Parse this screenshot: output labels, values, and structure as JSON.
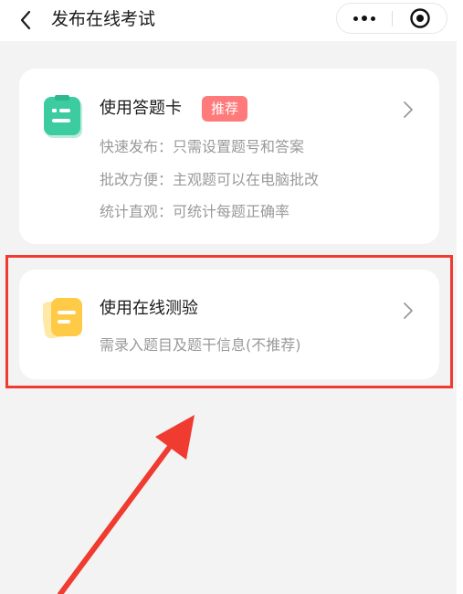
{
  "nav": {
    "title": "发布在线考试",
    "back_icon": "chevron-left-icon",
    "more_icon": "more-dots-icon",
    "close_icon": "target-circle-icon"
  },
  "options": [
    {
      "title": "使用答题卡",
      "badge": "推荐",
      "icon": "answer-sheet-icon",
      "icon_color": "#3dcca0",
      "descriptions": [
        "快速发布：只需设置题号和答案",
        "批改方便：主观题可以在电脑批改",
        "统计直观：可统计每题正确率"
      ]
    },
    {
      "title": "使用在线测验",
      "icon": "document-icon",
      "icon_color": "#ffcb47",
      "descriptions": [
        "需录入题目及题干信息(不推荐)"
      ]
    }
  ],
  "colors": {
    "page_background": "#f3f3f3",
    "badge": "#ff7a7a",
    "annotation": "#ef3b30"
  }
}
